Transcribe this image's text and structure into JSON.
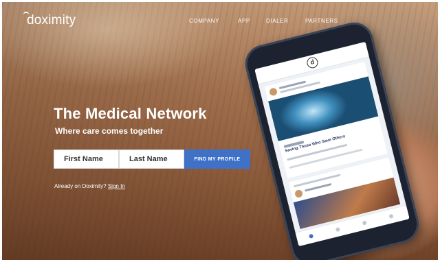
{
  "header": {
    "logo_text": "doximity",
    "nav": [
      "COMPANY",
      "APP",
      "DIALER",
      "PARTNERS"
    ]
  },
  "hero": {
    "title": "The Medical Network",
    "subtitle": "Where care comes together"
  },
  "form": {
    "first_name_placeholder": "First Name",
    "last_name_placeholder": "Last Name",
    "submit_label": "FIND MY PROFILE"
  },
  "signin": {
    "prompt": "Already on Doximity?",
    "link": "Sign In"
  },
  "colors": {
    "accent": "#3f72c7"
  },
  "phone_screen": {
    "app_icon": "doximity-d-icon",
    "post_title": "Saving Those Who Save Others"
  }
}
